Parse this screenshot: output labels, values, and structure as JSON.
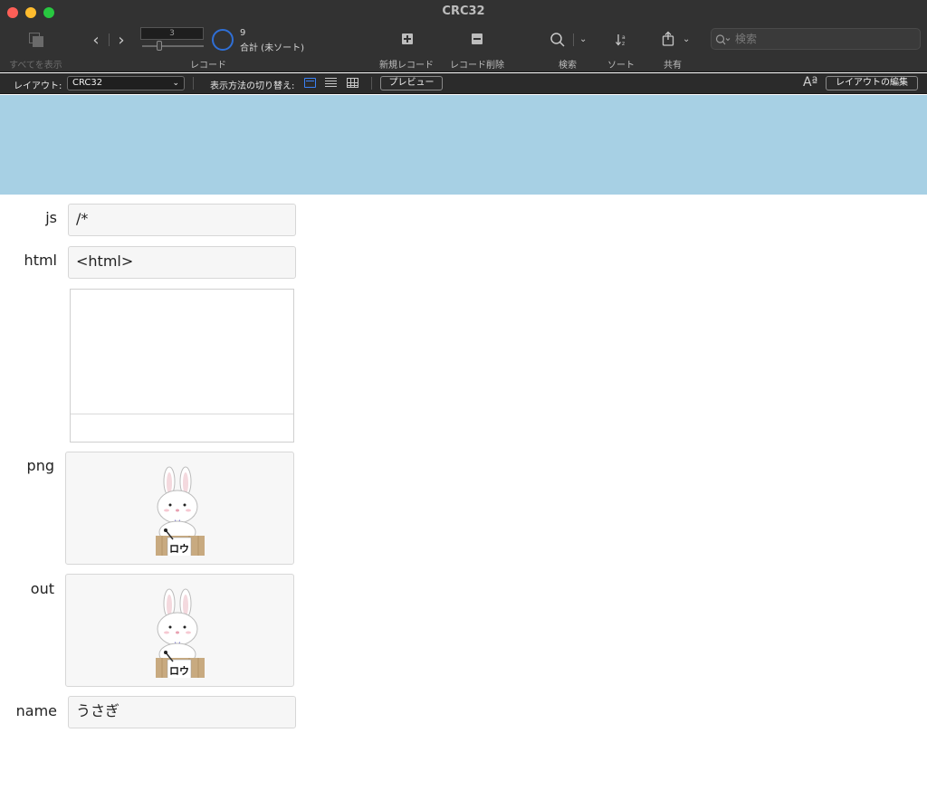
{
  "window": {
    "title": "CRC32"
  },
  "toolbar": {
    "show_all_label": "すべてを表示",
    "record_label": "レコード",
    "current_record": "3",
    "total_count": "9",
    "total_status": "合計 (未ソート)",
    "new_record_label": "新規レコード",
    "delete_record_label": "レコード削除",
    "find_label": "検索",
    "sort_label": "ソート",
    "share_label": "共有",
    "search_placeholder": "検索"
  },
  "layout_bar": {
    "layout_label": "レイアウト:",
    "layout_value": "CRC32",
    "view_as_label": "表示方法の切り替え:",
    "preview_label": "プレビュー",
    "edit_layout_label": "レイアウトの編集",
    "font_icon_text": "Aª"
  },
  "fields": {
    "js": {
      "label": "js",
      "value": "/*"
    },
    "html": {
      "label": "html",
      "value": "<html>"
    },
    "png": {
      "label": "png"
    },
    "out": {
      "label": "out"
    },
    "name": {
      "label": "name",
      "value": "うさぎ"
    }
  },
  "image_text": "ロウ",
  "colors": {
    "header_band": "#a7d0e4",
    "accent": "#3b82f6"
  }
}
